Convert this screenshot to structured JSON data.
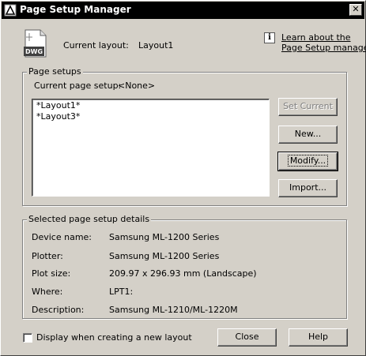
{
  "window": {
    "title": "Page Setup Manager",
    "close_glyph": "✕"
  },
  "header": {
    "current_layout_label": "Current layout:",
    "current_layout_value": "Layout1",
    "learn_link_line1": "Learn about the",
    "learn_link_line2": "Page Setup manager",
    "dwg_icon_text": "DWG"
  },
  "page_setups": {
    "group_title": "Page setups",
    "current_label": "Current page setup:",
    "current_value": "<None>",
    "items": [
      "*Layout1*",
      "*Layout3*"
    ]
  },
  "buttons": {
    "set_current": "Set Current",
    "new": "New...",
    "modify": "Modify...",
    "import": "Import...",
    "close": "Close",
    "help": "Help"
  },
  "details": {
    "group_title": "Selected page setup details",
    "rows": [
      {
        "label": "Device name:",
        "value": "Samsung ML-1200 Series"
      },
      {
        "label": "Plotter:",
        "value": "Samsung ML-1200 Series"
      },
      {
        "label": "Plot size:",
        "value": "209.97 x 296.93 mm (Landscape)"
      },
      {
        "label": "Where:",
        "value": "LPT1:"
      },
      {
        "label": "Description:",
        "value": "Samsung ML-1210/ML-1220M"
      }
    ]
  },
  "footer": {
    "checkbox_label": "Display when creating a new layout",
    "checkbox_checked": false
  },
  "colors": {
    "face": "#d4d0c8",
    "titlebar": "#000000",
    "shadow": "#808080"
  }
}
